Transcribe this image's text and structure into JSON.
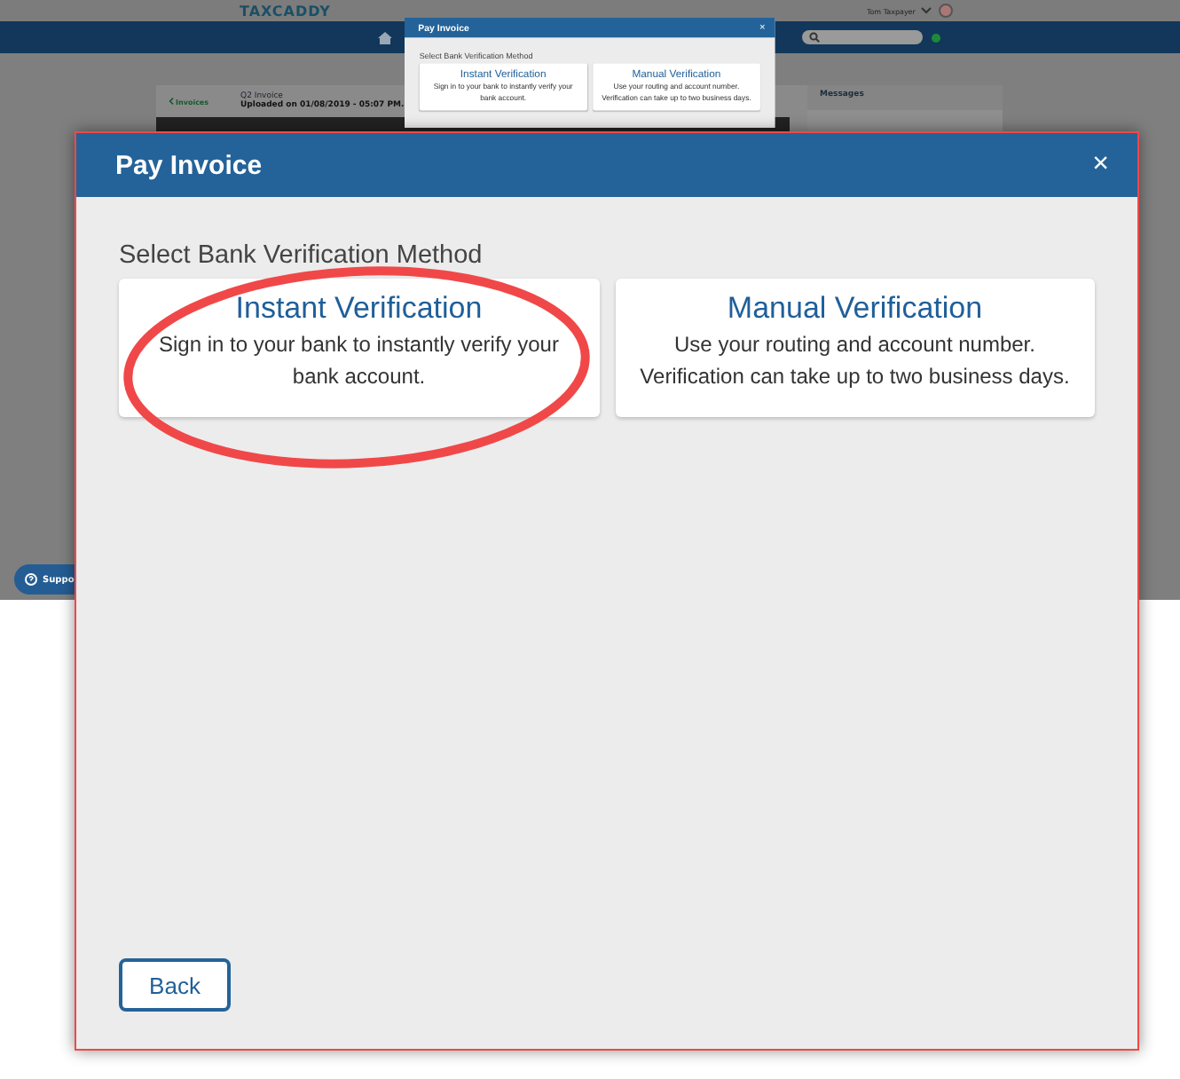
{
  "background_app": {
    "logo": "TAXCADDY",
    "user_name": "Tom Taxpayer",
    "back_link": "Invoices",
    "invoice_title": "Q2 Invoice",
    "uploaded": "Uploaded on 01/08/2019 - 05:07 PM.",
    "messages_title": "Messages",
    "support_label": "Suppo"
  },
  "small_dialog": {
    "title": "Pay Invoice",
    "close": "×",
    "prompt": "Select Bank Verification Method",
    "options": [
      {
        "title": "Instant Verification",
        "description": "Sign in to your bank to instantly verify your bank account."
      },
      {
        "title": "Manual Verification",
        "description": "Use your routing and account number. Verification can take up to two business days."
      }
    ]
  },
  "dialog": {
    "title": "Pay Invoice",
    "close": "×",
    "prompt": "Select Bank Verification Method",
    "options": [
      {
        "title": "Instant Verification",
        "description": "Sign in to your bank to instantly verify your bank account."
      },
      {
        "title": "Manual Verification",
        "description": "Use your routing and account number. Verification can take up to two business days."
      }
    ],
    "back_button": "Back"
  }
}
